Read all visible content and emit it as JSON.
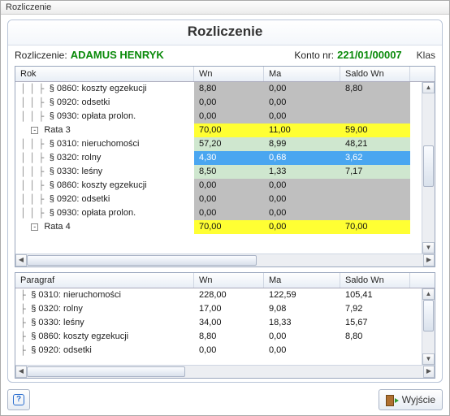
{
  "windowTitle": "Rozliczenie",
  "panelTitle": "Rozliczenie",
  "info": {
    "label1": "Rozliczenie:",
    "value1": "ADAMUS HENRYK",
    "label2": "Konto nr:",
    "value2": "221/01/00007",
    "trimRight": "Klas"
  },
  "topHeaders": {
    "c1": "Rok",
    "c2": "Wn",
    "c3": "Ma",
    "c4": "Saldo Wn"
  },
  "topRows": [
    {
      "type": "leaf",
      "indent": 3,
      "label": "§ 0860: koszty egzekucji",
      "wn": "8,80",
      "ma": "0,00",
      "sw": "8,80",
      "bg": "gray"
    },
    {
      "type": "leaf",
      "indent": 3,
      "label": "§ 0920: odsetki",
      "wn": "0,00",
      "ma": "0,00",
      "sw": "",
      "bg": "gray"
    },
    {
      "type": "leaf",
      "indent": 3,
      "label": "§ 0930: opłata prolon.",
      "wn": "0,00",
      "ma": "0,00",
      "sw": "",
      "bg": "gray"
    },
    {
      "type": "branch",
      "indent": 1,
      "expander": "-",
      "label": "Rata 3",
      "wn": "70,00",
      "ma": "11,00",
      "sw": "59,00",
      "bg": "yel"
    },
    {
      "type": "leaf",
      "indent": 3,
      "label": "§ 0310: nieruchomości",
      "wn": "57,20",
      "ma": "8,99",
      "sw": "48,21",
      "bg": "grn"
    },
    {
      "type": "leaf",
      "indent": 3,
      "label": "§ 0320: rolny",
      "wn": "4,30",
      "ma": "0,68",
      "sw": "3,62",
      "bg": "blue"
    },
    {
      "type": "leaf",
      "indent": 3,
      "label": "§ 0330: leśny",
      "wn": "8,50",
      "ma": "1,33",
      "sw": "7,17",
      "bg": "grn"
    },
    {
      "type": "leaf",
      "indent": 3,
      "label": "§ 0860: koszty egzekucji",
      "wn": "0,00",
      "ma": "0,00",
      "sw": "",
      "bg": "gray"
    },
    {
      "type": "leaf",
      "indent": 3,
      "label": "§ 0920: odsetki",
      "wn": "0,00",
      "ma": "0,00",
      "sw": "",
      "bg": "gray"
    },
    {
      "type": "leaf",
      "indent": 3,
      "label": "§ 0930: opłata prolon.",
      "wn": "0,00",
      "ma": "0,00",
      "sw": "",
      "bg": "gray"
    },
    {
      "type": "branch",
      "indent": 1,
      "expander": "-",
      "label": "Rata 4",
      "wn": "70,00",
      "ma": "0,00",
      "sw": "70,00",
      "bg": "yel"
    }
  ],
  "botHeaders": {
    "c1": "Paragraf",
    "c2": "Wn",
    "c3": "Ma",
    "c4": "Saldo Wn"
  },
  "botRows": [
    {
      "label": "§ 0310: nieruchomości",
      "wn": "228,00",
      "ma": "122,59",
      "sw": "105,41"
    },
    {
      "label": "§ 0320: rolny",
      "wn": "17,00",
      "ma": "9,08",
      "sw": "7,92"
    },
    {
      "label": "§ 0330: leśny",
      "wn": "34,00",
      "ma": "18,33",
      "sw": "15,67"
    },
    {
      "label": "§ 0860: koszty egzekucji",
      "wn": "8,80",
      "ma": "0,00",
      "sw": "8,80"
    },
    {
      "label": "§ 0920: odsetki",
      "wn": "0,00",
      "ma": "0,00",
      "sw": ""
    }
  ],
  "buttons": {
    "exit": "Wyjście"
  }
}
